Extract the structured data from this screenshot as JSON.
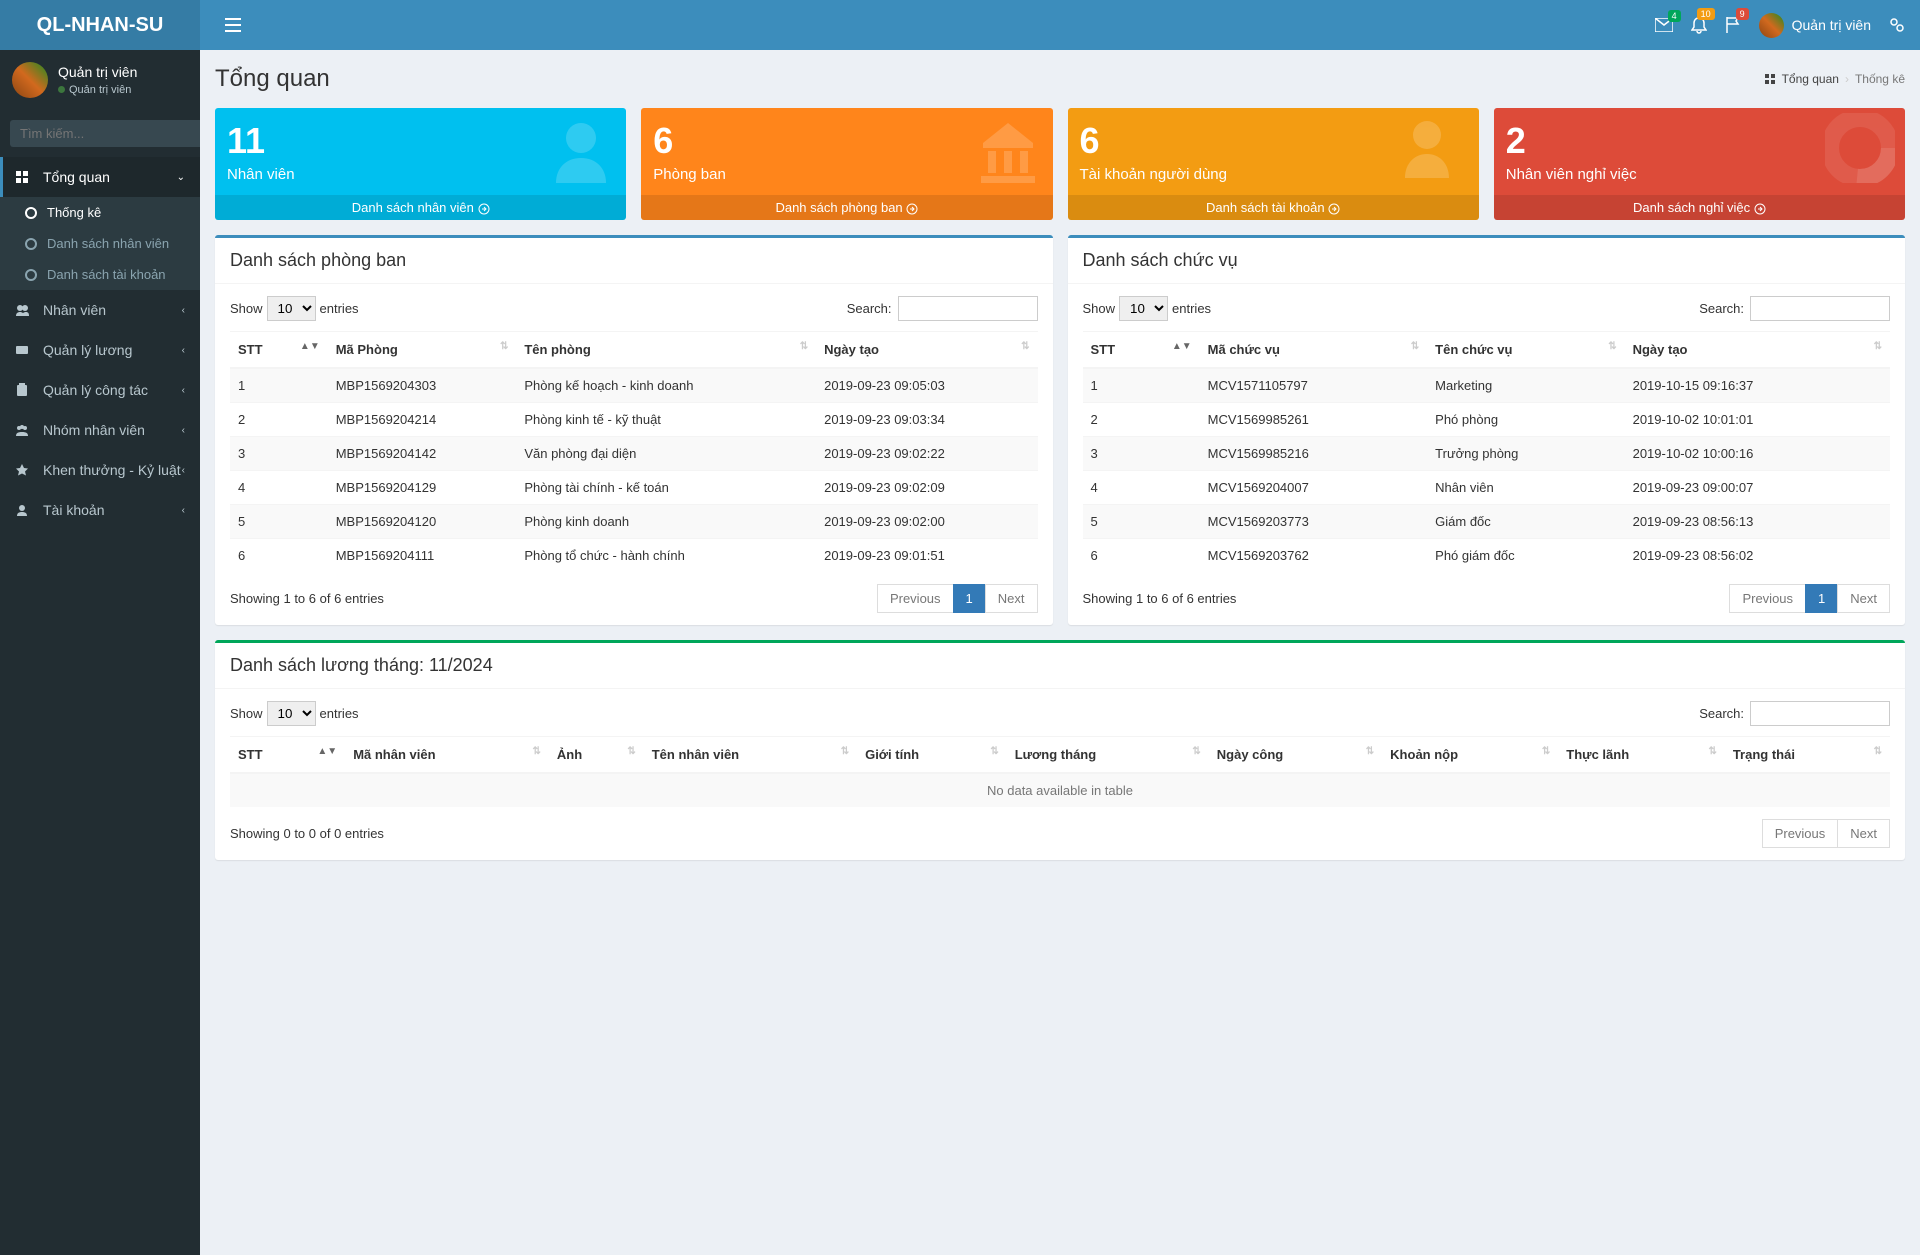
{
  "brand": "QL-NHAN-SU",
  "user": {
    "name": "Quản trị viên",
    "role": "Quản trị viên"
  },
  "notif": {
    "mail": "4",
    "bell": "10",
    "flag": "9"
  },
  "search_placeholder": "Tìm kiếm...",
  "menu": [
    {
      "label": "Tổng quan",
      "active": true,
      "sub": [
        {
          "label": "Thống kê",
          "active": true
        },
        {
          "label": "Danh sách nhân viên"
        },
        {
          "label": "Danh sách tài khoản"
        }
      ]
    },
    {
      "label": "Nhân viên"
    },
    {
      "label": "Quản lý lương"
    },
    {
      "label": "Quản lý công tác"
    },
    {
      "label": "Nhóm nhân viên"
    },
    {
      "label": "Khen thưởng - Kỷ luật"
    },
    {
      "label": "Tài khoản"
    }
  ],
  "page_title": "Tổng quan",
  "breadcrumb": {
    "root": "Tổng quan",
    "current": "Thống kê"
  },
  "cards": [
    {
      "value": "11",
      "label": "Nhân viên",
      "link": "Danh sách nhân viên",
      "color": "bg-aqua"
    },
    {
      "value": "6",
      "label": "Phòng ban",
      "link": "Danh sách phòng ban",
      "color": "bg-yellow2"
    },
    {
      "value": "6",
      "label": "Tài khoản người dùng",
      "link": "Danh sách tài khoản",
      "color": "bg-orange"
    },
    {
      "value": "2",
      "label": "Nhân viên nghỉ việc",
      "link": "Danh sách nghỉ việc",
      "color": "bg-red2"
    }
  ],
  "dt_labels": {
    "show": "Show",
    "entries": "entries",
    "search": "Search:",
    "prev": "Previous",
    "next": "Next",
    "page_size": "10"
  },
  "phongban": {
    "title": "Danh sách phòng ban",
    "cols": [
      "STT",
      "Mã Phòng",
      "Tên phòng",
      "Ngày tạo"
    ],
    "rows": [
      [
        "1",
        "MBP1569204303",
        "Phòng kế hoạch - kinh doanh",
        "2019-09-23 09:05:03"
      ],
      [
        "2",
        "MBP1569204214",
        "Phòng kinh tế - kỹ thuật",
        "2019-09-23 09:03:34"
      ],
      [
        "3",
        "MBP1569204142",
        "Văn phòng đại diện",
        "2019-09-23 09:02:22"
      ],
      [
        "4",
        "MBP1569204129",
        "Phòng tài chính - kế toán",
        "2019-09-23 09:02:09"
      ],
      [
        "5",
        "MBP1569204120",
        "Phòng kinh doanh",
        "2019-09-23 09:02:00"
      ],
      [
        "6",
        "MBP1569204111",
        "Phòng tổ chức - hành chính",
        "2019-09-23 09:01:51"
      ]
    ],
    "info": "Showing 1 to 6 of 6 entries"
  },
  "chucvu": {
    "title": "Danh sách chức vụ",
    "cols": [
      "STT",
      "Mã chức vụ",
      "Tên chức vụ",
      "Ngày tạo"
    ],
    "rows": [
      [
        "1",
        "MCV1571105797",
        "Marketing",
        "2019-10-15 09:16:37"
      ],
      [
        "2",
        "MCV1569985261",
        "Phó phòng",
        "2019-10-02 10:01:01"
      ],
      [
        "3",
        "MCV1569985216",
        "Trưởng phòng",
        "2019-10-02 10:00:16"
      ],
      [
        "4",
        "MCV1569204007",
        "Nhân viên",
        "2019-09-23 09:00:07"
      ],
      [
        "5",
        "MCV1569203773",
        "Giám đốc",
        "2019-09-23 08:56:13"
      ],
      [
        "6",
        "MCV1569203762",
        "Phó giám đốc",
        "2019-09-23 08:56:02"
      ]
    ],
    "info": "Showing 1 to 6 of 6 entries"
  },
  "luong": {
    "title": "Danh sách lương tháng: 11/2024",
    "cols": [
      "STT",
      "Mã nhân viên",
      "Ảnh",
      "Tên nhân viên",
      "Giới tính",
      "Lương tháng",
      "Ngày công",
      "Khoản nộp",
      "Thực lãnh",
      "Trạng thái"
    ],
    "empty": "No data available in table",
    "info": "Showing 0 to 0 of 0 entries"
  }
}
